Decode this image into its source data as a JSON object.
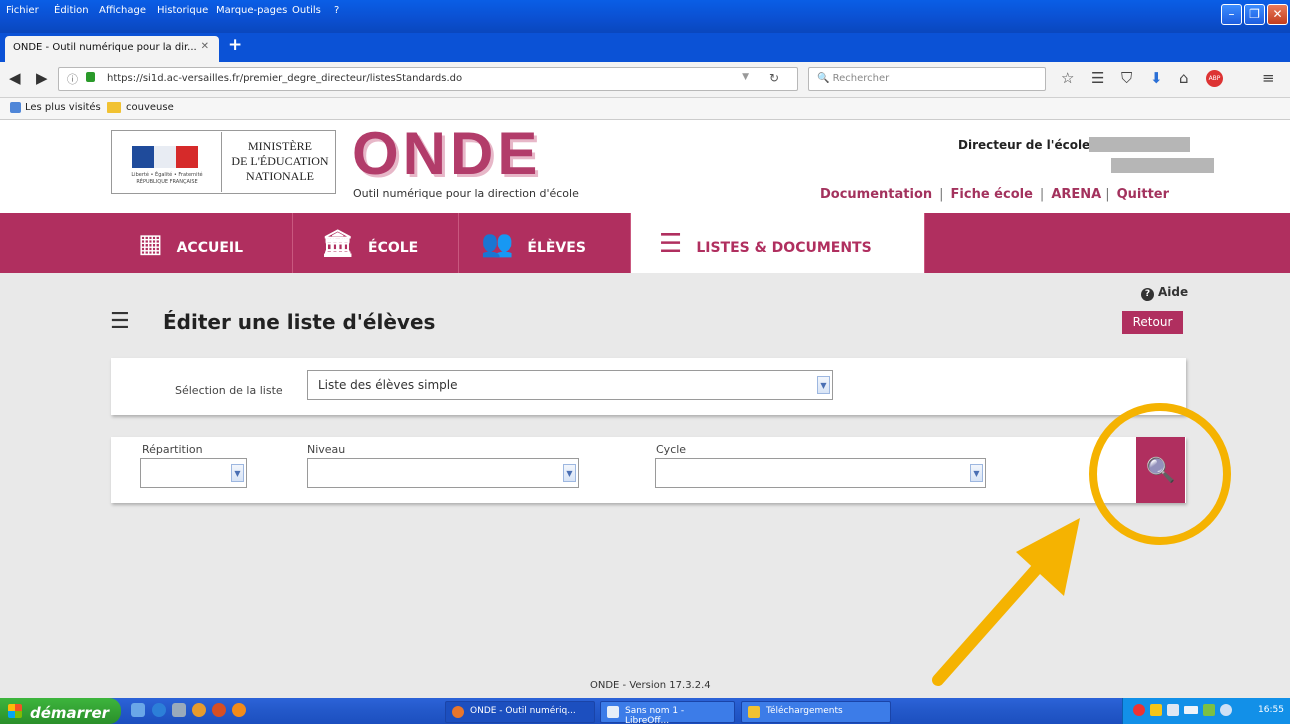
{
  "browser": {
    "menu": [
      "Fichier",
      "Édition",
      "Affichage",
      "Historique",
      "Marque-pages",
      "Outils",
      "?"
    ],
    "tab_title": "ONDE - Outil numérique pour la dir...",
    "url": "https://si1d.ac-versailles.fr/premier_degre_directeur/listesStandards.do",
    "search_placeholder": "Rechercher",
    "bookmarks": [
      "Les plus visités",
      "couveuse"
    ]
  },
  "header": {
    "ministry": [
      "MINISTÈRE",
      "DE L'ÉDUCATION",
      "NATIONALE"
    ],
    "motto": "Liberté • Égalité • Fraternité",
    "republic": "RÉPUBLIQUE FRANÇAISE",
    "app_name": "ONDE",
    "tagline": "Outil numérique pour la direction d'école",
    "director_label": "Directeur de l'école",
    "links": [
      "Documentation",
      "Fiche école",
      "ARENA",
      "Quitter"
    ]
  },
  "nav": {
    "items": [
      {
        "label": "ACCUEIL",
        "icon": "grid-icon"
      },
      {
        "label": "ÉCOLE",
        "icon": "building-icon"
      },
      {
        "label": "ÉLÈVES",
        "icon": "students-icon"
      },
      {
        "label": "LISTES & DOCUMENTS",
        "icon": "list-icon"
      }
    ]
  },
  "page": {
    "help_label": "Aide",
    "back_label": "Retour",
    "title": "Éditer une liste d'élèves",
    "selection_label": "Sélection de la liste",
    "selection_value": "Liste des élèves simple",
    "filters": {
      "repartition_label": "Répartition",
      "niveau_label": "Niveau",
      "cycle_label": "Cycle"
    },
    "version": "ONDE - Version 17.3.2.4"
  },
  "taskbar": {
    "start_label": "démarrer",
    "tasks": [
      "ONDE - Outil numériq...",
      "Sans nom 1 - LibreOff...",
      "Téléchargements"
    ],
    "clock": "16:55"
  },
  "colors": {
    "brand": "#b02f5f",
    "annotation": "#f5b301"
  }
}
